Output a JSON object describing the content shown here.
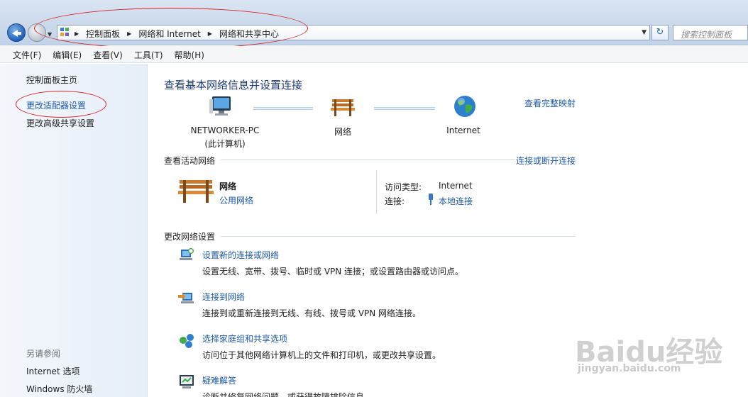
{
  "address": {
    "breadcrumbs": [
      "控制面板",
      "网络和 Internet",
      "网络和共享中心"
    ],
    "search_placeholder": "搜索控制面板"
  },
  "menu": [
    "文件(F)",
    "编辑(E)",
    "查看(V)",
    "工具(T)",
    "帮助(H)"
  ],
  "sidebar": {
    "home": "控制面板主页",
    "links": [
      "更改适配器设置",
      "更改高级共享设置"
    ],
    "see_also_title": "另请参阅",
    "see_also": [
      "Internet 选项",
      "Windows 防火墙"
    ]
  },
  "main": {
    "title": "查看基本网络信息并设置连接",
    "view_full_map": "查看完整映射",
    "nodes": [
      {
        "label": "NETWORKER-PC",
        "sub": "(此计算机)",
        "icon": "computer-icon"
      },
      {
        "label": "网络",
        "sub": "",
        "icon": "bench-icon"
      },
      {
        "label": "Internet",
        "sub": "",
        "icon": "globe-icon"
      }
    ],
    "active_networks": {
      "title": "查看活动网络",
      "connect_link": "连接或断开连接",
      "network_name": "网络",
      "network_type": "公用网络",
      "access_type_label": "访问类型:",
      "access_type_value": "Internet",
      "connections_label": "连接:",
      "connections_value": "本地连接"
    },
    "change_settings": {
      "title": "更改网络设置",
      "tasks": [
        {
          "title": "设置新的连接或网络",
          "desc": "设置无线、宽带、拨号、临时或 VPN 连接；或设置路由器或访问点。",
          "icon": "new-connection-icon"
        },
        {
          "title": "连接到网络",
          "desc": "连接到或重新连接到无线、有线、拨号或 VPN 网络连接。",
          "icon": "connect-network-icon"
        },
        {
          "title": "选择家庭组和共享选项",
          "desc": "访问位于其他网络计算机上的文件和打印机，或更改共享设置。",
          "icon": "homegroup-icon"
        },
        {
          "title": "疑难解答",
          "desc": "诊断并修复网络问题，或获得故障排除信息。",
          "icon": "troubleshoot-icon"
        }
      ]
    }
  },
  "watermark": {
    "logo": "Baidu经验",
    "url": "jingyan.baidu.com"
  },
  "colors": {
    "link": "#1e5aa8",
    "title": "#1e3a78",
    "annotation": "#d42020"
  }
}
